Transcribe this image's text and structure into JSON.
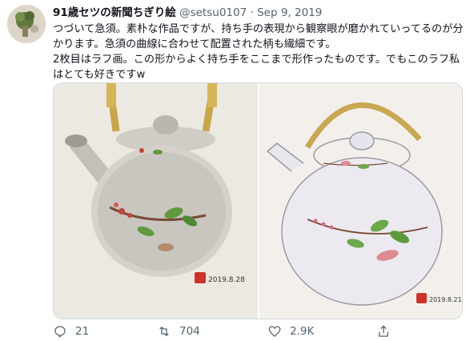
{
  "tweet": {
    "author_name": "91歳セツの新聞ちぎり絵",
    "handle": "@setsu0107",
    "separator": "·",
    "date": "Sep 9, 2019",
    "text": "つづいて急須。素朴な作品ですが、持ち手の表現から観察眼が磨かれていってるのが分かります。急須の曲線に合わせて配置された柄も繊細です。\n2枚目はラフ画。この形からよく持ち手をここまで形作ったものです。でもこのラフ私はとても好きですw",
    "image1": {
      "signature_date": "2019.8.28"
    },
    "image2": {
      "signature_date": "2019.8.21"
    }
  },
  "actions": {
    "reply_count": "21",
    "retweet_count": "704",
    "like_count": "2.9K"
  },
  "icons": [
    "avatar",
    "reply-icon",
    "retweet-icon",
    "like-icon",
    "share-icon"
  ],
  "colors": {
    "text": "#0f1419",
    "secondary": "#536471",
    "border": "#cfd9de"
  }
}
